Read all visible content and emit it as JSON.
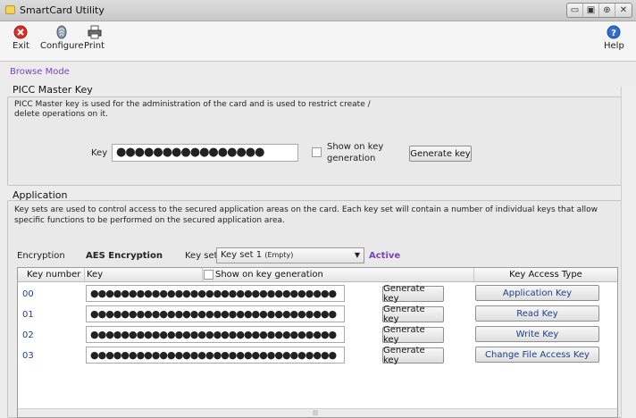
{
  "window": {
    "title": "SmartCard Utility"
  },
  "toolbar": {
    "exit_label": "Exit",
    "configure_label": "Configure",
    "print_label": "Print",
    "help_label": "Help"
  },
  "mode": "Browse Mode",
  "picc": {
    "title": "PICC Master Key",
    "description_line1": "PICC Master key is used for the administration of the card and is used to restrict create /",
    "description_line2": "delete operations on it.",
    "key_label": "Key",
    "key_value": "●●●●●●●●●●●●●●●●",
    "show_label_line1": "Show on key",
    "show_label_line2": "generation",
    "generate_label": "Generate key"
  },
  "application": {
    "title": "Application",
    "description_line1": "Key sets are used to control access to the secured application areas on the card.  Each key set will contain a number of individual keys that allow",
    "description_line2": "specific functions to be performed on the secured application area.",
    "encryption_label": "Encryption",
    "encryption_value": "AES Encryption",
    "keyset_label": "Key set",
    "keyset_value": "Key set 1",
    "keyset_suffix": "(Empty)",
    "status": "Active",
    "columns": {
      "key_number": "Key number",
      "key": "Key",
      "show": "Show on key generation",
      "access_type": "Key Access Type"
    },
    "rows": [
      {
        "num": "00",
        "key": "●●●●●●●●●●●●●●●●●●●●●●●●●●●●●●●●",
        "generate": "Generate key",
        "access": "Application Key"
      },
      {
        "num": "01",
        "key": "●●●●●●●●●●●●●●●●●●●●●●●●●●●●●●●●",
        "generate": "Generate key",
        "access": "Read Key"
      },
      {
        "num": "02",
        "key": "●●●●●●●●●●●●●●●●●●●●●●●●●●●●●●●●",
        "generate": "Generate key",
        "access": "Write Key"
      },
      {
        "num": "03",
        "key": "●●●●●●●●●●●●●●●●●●●●●●●●●●●●●●●●",
        "generate": "Generate key",
        "access": "Change File Access Key"
      }
    ]
  },
  "icons": {
    "exit": "close-circle-icon",
    "configure": "fingerprint-icon",
    "print": "printer-icon",
    "help": "help-icon"
  },
  "colors": {
    "accent": "#7b3fbf",
    "link_blue": "#1b3f8c",
    "exit_red": "#d93025",
    "help_blue": "#2f6fcf"
  }
}
